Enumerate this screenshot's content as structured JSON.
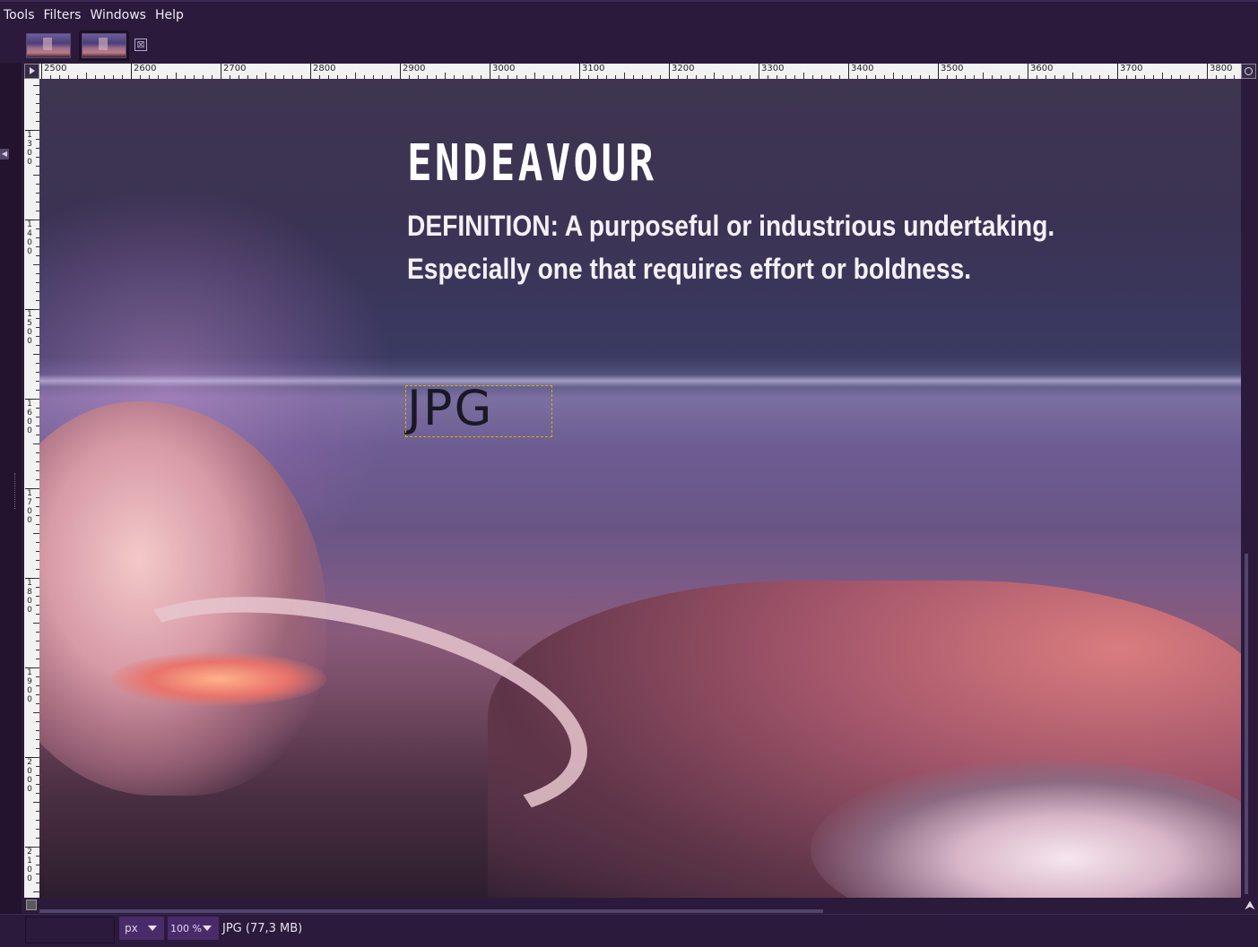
{
  "menubar": {
    "items": [
      {
        "label": "Tools"
      },
      {
        "label": "Filters"
      },
      {
        "label": "Windows"
      },
      {
        "label": "Help"
      }
    ]
  },
  "tabs": {
    "close_symbol": "⊠"
  },
  "ruler_h": {
    "labels": [
      "2500",
      "2600",
      "2700",
      "2800",
      "2900",
      "3000",
      "3100",
      "3200",
      "3300",
      "3400",
      "3500",
      "3600",
      "3700",
      "3800"
    ]
  },
  "ruler_v": {
    "labels": [
      "1300",
      "1400",
      "1500",
      "1600",
      "1700",
      "1800",
      "1900",
      "2000",
      "2100"
    ]
  },
  "canvas": {
    "title": "ENDEAVOUR",
    "definition_line1": "DEFINITION: A purposeful or industrious undertaking.",
    "definition_line2": "Especially one that requires effort or boldness.",
    "text_layer": "JPG"
  },
  "statusbar": {
    "unit": "px",
    "zoom": "100 %",
    "info": "JPG (77,3 MB)"
  },
  "colors": {
    "chrome_bg": "#2b1a3c",
    "selection_border": "#d8b000",
    "dropdown_bg": "#4a2b6a"
  }
}
